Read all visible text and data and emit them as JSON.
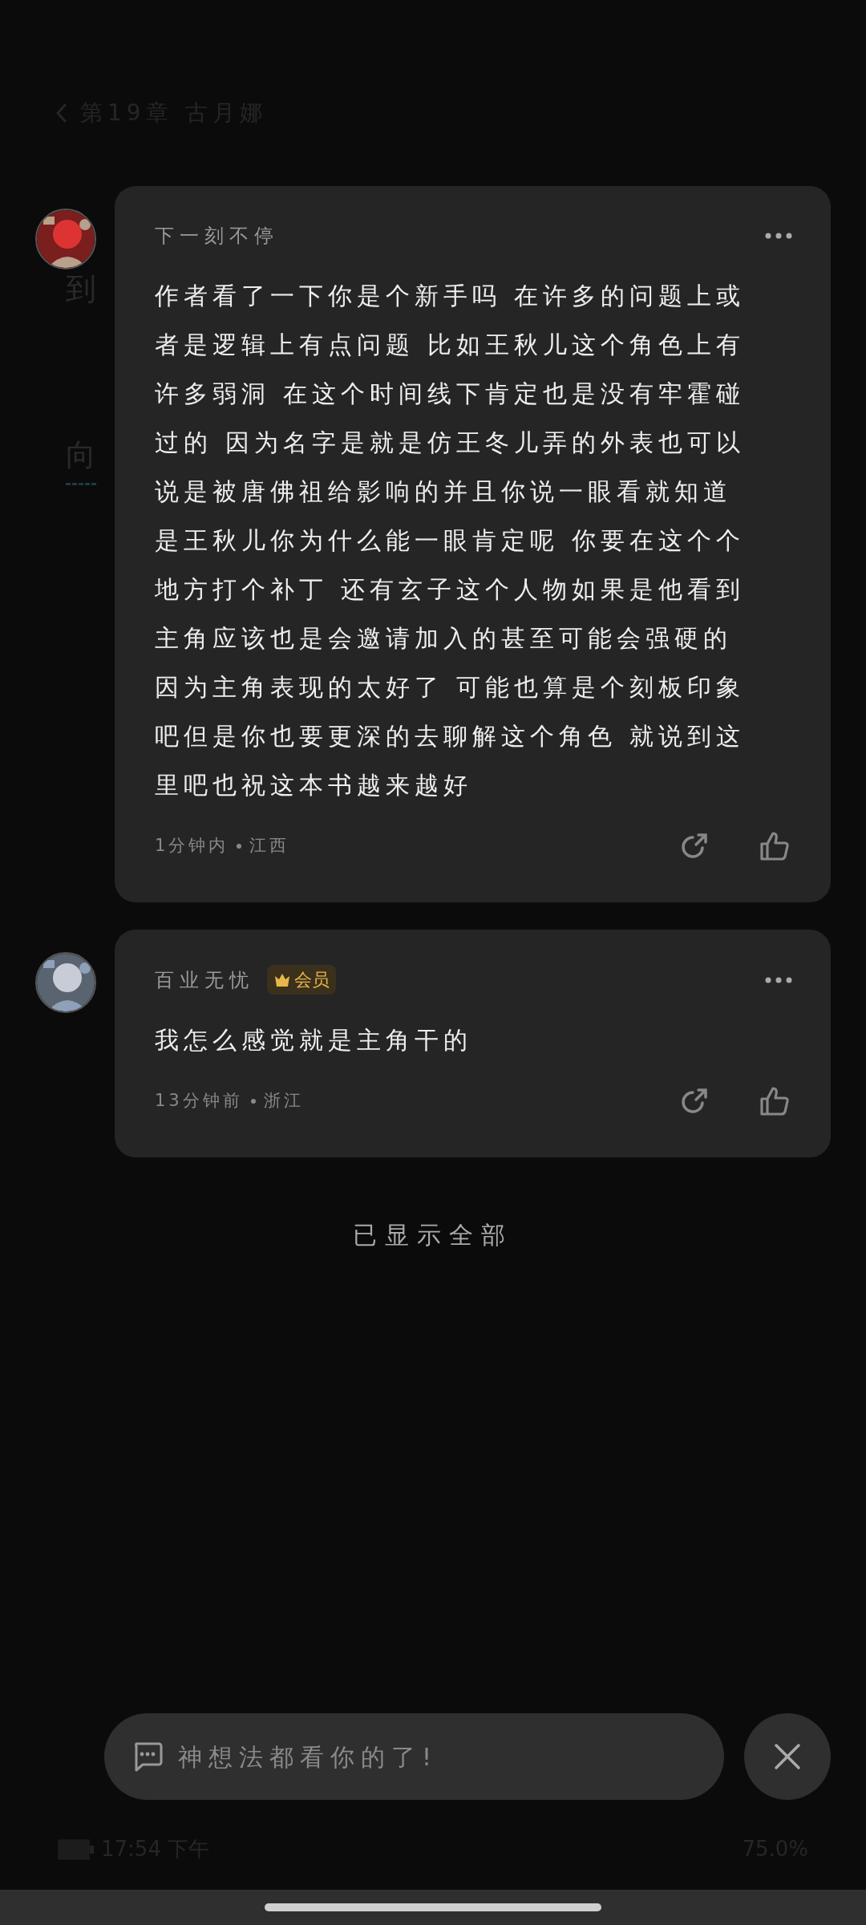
{
  "header": {
    "title": "第19章 古月娜"
  },
  "background_text": [
    "到",
    "向"
  ],
  "comments": [
    {
      "author": "下一刻不停",
      "body_lines": [
        "作者看了一下你是个新手吗 在许多的问题上或",
        "者是逻辑上有点问题 比如王秋儿这个角色上有",
        "许多弱洞 在这个时间线下肯定也是没有牢霍碰",
        "过的 因为名字是就是仿王冬儿弄的外表也可以",
        "说是被唐佛祖给影响的并且你说一眼看就知道",
        "是王秋儿你为什么能一眼肯定呢 你要在这个个",
        "地方打个补丁 还有玄子这个人物如果是他看到",
        "主角应该也是会邀请加入的甚至可能会强硬的",
        "因为主角表现的太好了 可能也算是个刻板印象",
        "吧但是你也要更深的去聊解这个角色 就说到这",
        "里吧也祝这本书越来越好"
      ],
      "time": "1分钟内",
      "location": "江西"
    },
    {
      "author": "百业无忧",
      "badge": "会员",
      "body_lines": [
        "我怎么感觉就是主角干的"
      ],
      "time": "13分钟前",
      "location": "浙江"
    }
  ],
  "footer_note": "已显示全部",
  "composer": {
    "placeholder": "神想法都看你的了!"
  },
  "status": {
    "time": "17:54 下午",
    "battery": "75.0%"
  }
}
